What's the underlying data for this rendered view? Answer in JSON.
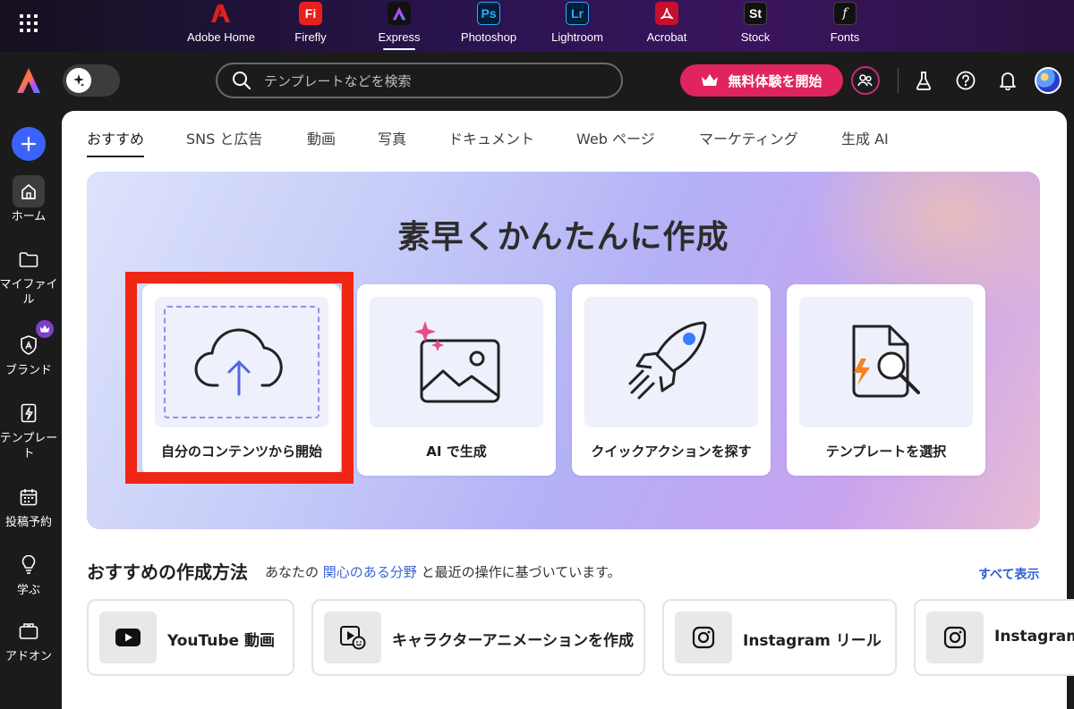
{
  "app_switcher": {
    "apps": [
      {
        "label": "Adobe Home",
        "icon": "adobe-home-icon",
        "glyph": "",
        "color": "#e0201b"
      },
      {
        "label": "Firefly",
        "icon": "firefly-icon",
        "glyph": "Fi",
        "color": "#e8201b"
      },
      {
        "label": "Express",
        "icon": "express-icon",
        "glyph": "",
        "color": "#111111"
      },
      {
        "label": "Photoshop",
        "icon": "photoshop-icon",
        "glyph": "Ps",
        "color": "#001e36"
      },
      {
        "label": "Lightroom",
        "icon": "lightroom-icon",
        "glyph": "Lr",
        "color": "#001e36"
      },
      {
        "label": "Acrobat",
        "icon": "acrobat-icon",
        "glyph": "",
        "color": "#c8102e"
      },
      {
        "label": "Stock",
        "icon": "stock-icon",
        "glyph": "St",
        "color": "#111111"
      },
      {
        "label": "Fonts",
        "icon": "fonts-icon",
        "glyph": "f",
        "color": "#111111"
      }
    ],
    "active": "Express"
  },
  "header": {
    "search_placeholder": "テンプレートなどを検索",
    "trial_button": "無料体験を開始",
    "trial_color": "#e0245e"
  },
  "sidebar": {
    "create_icon": "plus-icon",
    "items": [
      {
        "label": "ホーム",
        "icon": "home-icon"
      },
      {
        "label": "マイファイル",
        "icon": "folder-icon"
      },
      {
        "label": "ブランド",
        "icon": "brand-icon"
      },
      {
        "label": "テンプレート",
        "icon": "template-icon"
      },
      {
        "label": "投稿予約",
        "icon": "calendar-icon"
      },
      {
        "label": "学ぶ",
        "icon": "lightbulb-icon"
      },
      {
        "label": "アドオン",
        "icon": "addon-icon"
      }
    ]
  },
  "tabs": [
    "おすすめ",
    "SNS と広告",
    "動画",
    "写真",
    "ドキュメント",
    "Web ページ",
    "マーケティング",
    "生成 AI"
  ],
  "hero": {
    "title": "素早くかんたんに作成",
    "cards": [
      {
        "label": "自分のコンテンツから開始",
        "icon": "cloud-upload-icon"
      },
      {
        "label": "AI で生成",
        "icon": "ai-image-icon"
      },
      {
        "label": "クイックアクションを探す",
        "icon": "rocket-icon"
      },
      {
        "label": "テンプレートを選択",
        "icon": "template-search-icon"
      }
    ]
  },
  "recommend": {
    "title": "おすすめの作成方法",
    "subtitle_before": "あなたの",
    "subtitle_link": "関心のある分野",
    "subtitle_after": "と最近の操作に基づいています。",
    "see_all": "すべて表示",
    "cards": [
      {
        "label": "YouTube 動画",
        "icon": "youtube-icon"
      },
      {
        "label": "キャラクターアニメーションを作成",
        "icon": "character-animation-icon"
      },
      {
        "label": "Instagram リール",
        "icon": "instagram-icon"
      },
      {
        "label": "Instagram",
        "icon": "instagram-icon"
      }
    ]
  }
}
